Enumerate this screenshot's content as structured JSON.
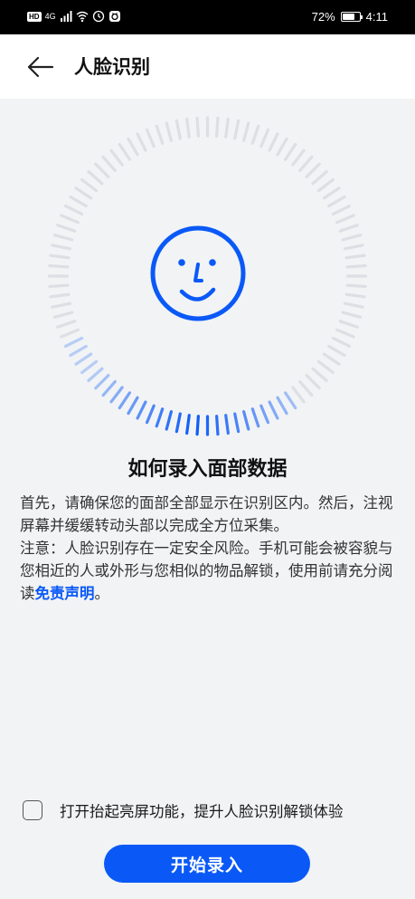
{
  "status_bar": {
    "hd": "HD",
    "network": "4G",
    "battery_percent": "72%",
    "battery_level": 0.72,
    "time": "4:11"
  },
  "header": {
    "title": "人脸识别",
    "back_icon": "arrow-left-icon"
  },
  "scan": {
    "progress": 0.3,
    "accent_color": "#0a59f7",
    "face_icon": "smiley-face-icon"
  },
  "content": {
    "title": "如何录入面部数据",
    "instruction": "首先，请确保您的面部全部显示在识别区内。然后，注视屏幕并缓缓转动头部以完成全方位采集。",
    "notice_prefix": "注意：人脸识别存在一定安全风险。手机可能会被容貌与您相近的人或外形与您相似的物品解锁，使用前请充分阅读",
    "disclaimer_link": "免责声明",
    "notice_suffix": "。"
  },
  "option": {
    "label": "打开抬起亮屏功能，提升人脸识别解锁体验",
    "checked": false
  },
  "actions": {
    "start_label": "开始录入"
  }
}
